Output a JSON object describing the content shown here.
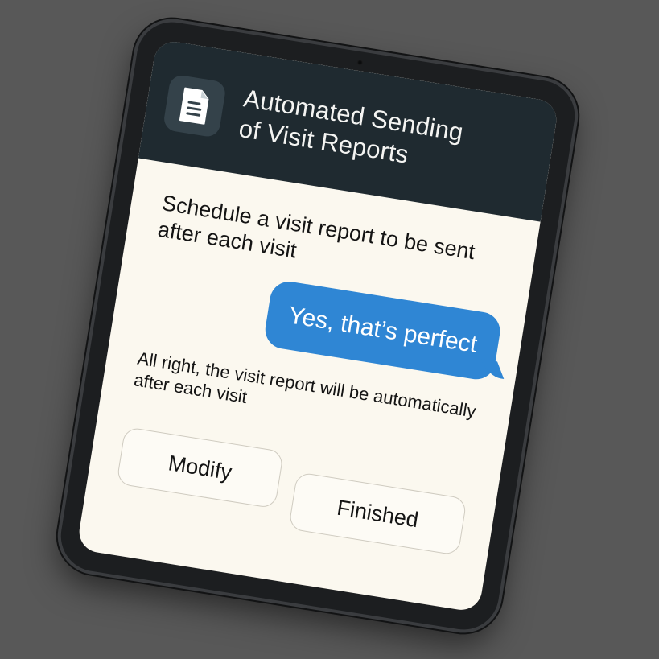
{
  "header": {
    "icon": "document-icon",
    "title_line1": "Automated Sending",
    "title_line2": "of Visit Reports"
  },
  "conversation": {
    "prompt": "Schedule a visit report to be sent after each visit",
    "user_reply": "Yes, that’s perfect",
    "confirmation": "All right, the visit report will be automatically after each visit"
  },
  "actions": {
    "modify_label": "Modify",
    "finished_label": "Finished"
  },
  "colors": {
    "header_bg": "#1f2a30",
    "bubble_bg": "#2f86d4",
    "screen_bg": "#fbf8ef"
  }
}
